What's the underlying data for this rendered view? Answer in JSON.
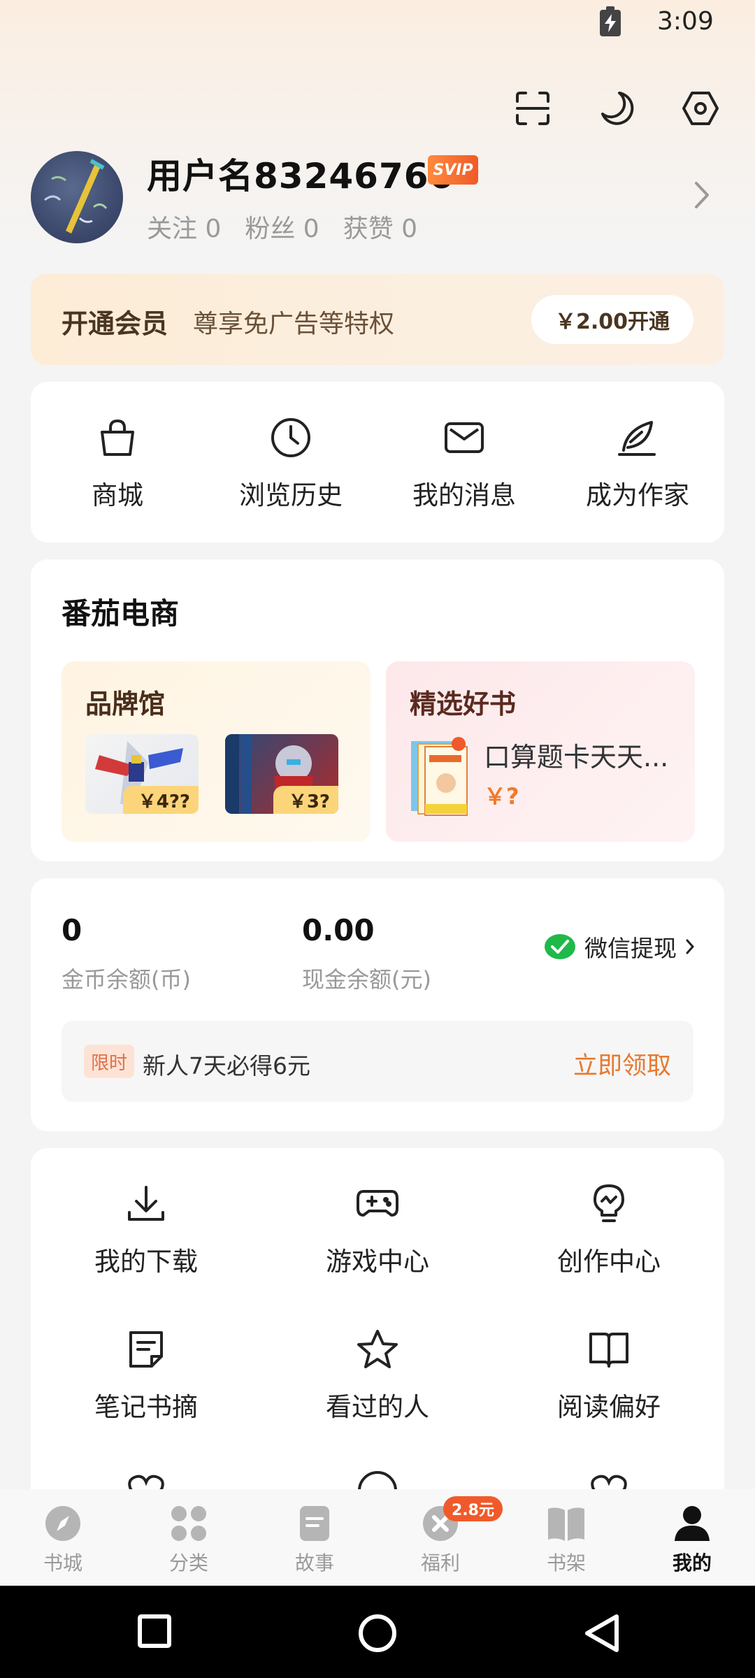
{
  "status_bar": {
    "time": "3:09"
  },
  "header_icons": [
    "scan-icon",
    "night-mode-icon",
    "settings-icon"
  ],
  "profile": {
    "username": "用户名83246766",
    "badge": "SVIP",
    "following": "关注 0",
    "followers": "粉丝 0",
    "likes": "获赞 0"
  },
  "vip": {
    "title": "开通会员",
    "desc": "尊享免广告等特权",
    "button": "￥2.00开通"
  },
  "quick_menu": [
    {
      "label": "商城",
      "icon": "shopping-bag-icon"
    },
    {
      "label": "浏览历史",
      "icon": "clock-icon"
    },
    {
      "label": "我的消息",
      "icon": "mail-icon"
    },
    {
      "label": "成为作家",
      "icon": "feather-pen-icon"
    }
  ],
  "ecommerce": {
    "title": "番茄电商",
    "brand": {
      "title": "品牌馆",
      "prices": [
        "￥4??",
        "￥3?"
      ]
    },
    "picks": {
      "title": "精选好书",
      "book_name": "口算题卡天天...",
      "book_price": "￥?"
    }
  },
  "wallet": {
    "coins_value": "0",
    "coins_label": "金币余额(币)",
    "cash_value": "0.00",
    "cash_label": "现金余额(元)",
    "withdraw": "微信提现",
    "promo_tag": "限时",
    "promo_text": "新人7天必得6元",
    "promo_link": "立即领取"
  },
  "tools": [
    {
      "label": "我的下载",
      "icon": "download-icon"
    },
    {
      "label": "游戏中心",
      "icon": "gamepad-icon"
    },
    {
      "label": "创作中心",
      "icon": "lightbulb-icon"
    },
    {
      "label": "笔记书摘",
      "icon": "note-icon"
    },
    {
      "label": "看过的人",
      "icon": "star-icon"
    },
    {
      "label": "阅读偏好",
      "icon": "open-book-icon"
    }
  ],
  "bottom_nav": [
    {
      "label": "书城",
      "icon": "compass-icon"
    },
    {
      "label": "分类",
      "icon": "grid-icon"
    },
    {
      "label": "故事",
      "icon": "story-icon"
    },
    {
      "label": "福利",
      "icon": "gift-coin-icon",
      "badge": "2.8元"
    },
    {
      "label": "书架",
      "icon": "bookshelf-icon"
    },
    {
      "label": "我的",
      "icon": "person-icon",
      "active": true
    }
  ]
}
